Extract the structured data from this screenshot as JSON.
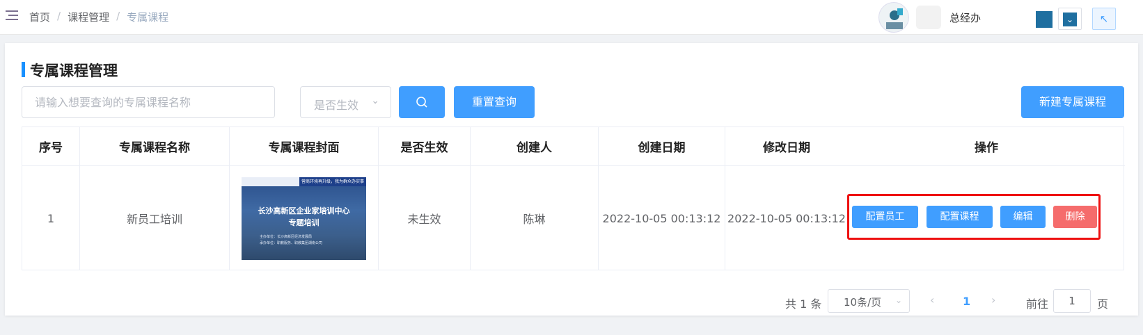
{
  "header": {
    "breadcrumb": [
      "首页",
      "课程管理",
      "专属课程"
    ],
    "breadcrumb_sep": "/",
    "role": "总经办"
  },
  "page": {
    "title": "专属课程管理",
    "search_placeholder": "请输入想要查询的专属课程名称",
    "status_select": "是否生效",
    "reset_label": "重置查询",
    "new_label": "新建专属课程"
  },
  "table": {
    "columns": [
      "序号",
      "专属课程名称",
      "专属课程封面",
      "是否生效",
      "创建人",
      "创建日期",
      "修改日期",
      "操作"
    ],
    "rows": [
      {
        "index": "1",
        "name": "新员工培训",
        "cover": {
          "banner": "营商环境再升级，我为群众办实事",
          "title1": "长沙高新区企业家培训中心",
          "title2": "专题培训",
          "sub1": "主办单位：长沙高新区经济发展局",
          "sub2": "承办单位：职教服务、职教集团湖南公司"
        },
        "status": "未生效",
        "creator": "陈琳",
        "created": "2022-10-05 00:13:12",
        "modified": "2022-10-05 00:13:12",
        "actions": [
          "配置员工",
          "配置课程",
          "编辑",
          "删除"
        ]
      }
    ]
  },
  "pagination": {
    "total": "共 1 条",
    "page_size": "10条/页",
    "current": "1",
    "goto_label": "前往",
    "goto_value": "1",
    "page_suffix": "页"
  },
  "colors": {
    "primary": "#409eff",
    "danger": "#f56c6c",
    "highlight": "#ee1111"
  }
}
